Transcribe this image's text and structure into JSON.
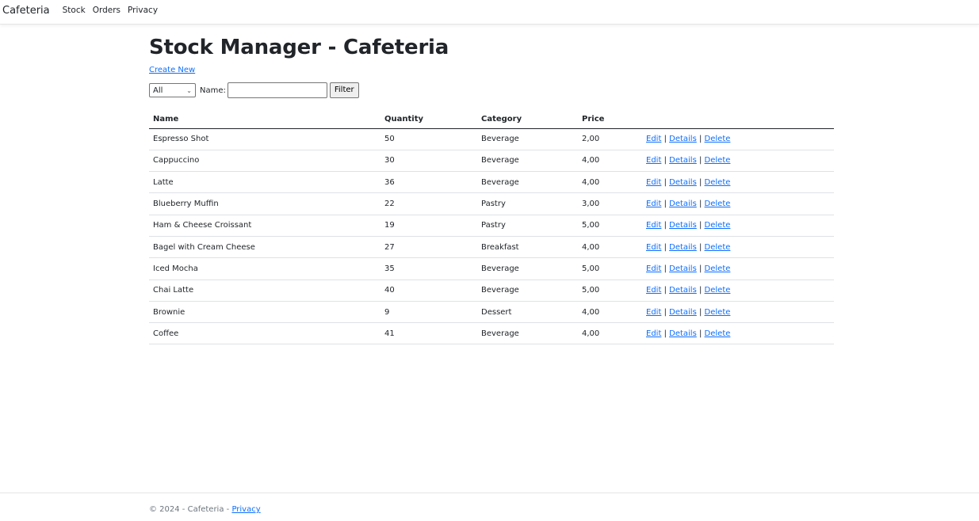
{
  "nav": {
    "brand": "Cafeteria",
    "links": [
      "Stock",
      "Orders",
      "Privacy"
    ]
  },
  "page": {
    "title": "Stock Manager - Cafeteria",
    "create_new": "Create New"
  },
  "filter": {
    "category_selected": "All",
    "name_label": "Name:",
    "name_value": "",
    "button_label": "Filter"
  },
  "table": {
    "headers": [
      "Name",
      "Quantity",
      "Category",
      "Price"
    ],
    "rows": [
      {
        "name": "Espresso Shot",
        "quantity": "50",
        "category": "Beverage",
        "price": "2,00"
      },
      {
        "name": "Cappuccino",
        "quantity": "30",
        "category": "Beverage",
        "price": "4,00"
      },
      {
        "name": "Latte",
        "quantity": "36",
        "category": "Beverage",
        "price": "4,00"
      },
      {
        "name": "Blueberry Muffin",
        "quantity": "22",
        "category": "Pastry",
        "price": "3,00"
      },
      {
        "name": "Ham & Cheese Croissant",
        "quantity": "19",
        "category": "Pastry",
        "price": "5,00"
      },
      {
        "name": "Bagel with Cream Cheese",
        "quantity": "27",
        "category": "Breakfast",
        "price": "4,00"
      },
      {
        "name": "Iced Mocha",
        "quantity": "35",
        "category": "Beverage",
        "price": "5,00"
      },
      {
        "name": "Chai Latte",
        "quantity": "40",
        "category": "Beverage",
        "price": "5,00"
      },
      {
        "name": "Brownie",
        "quantity": "9",
        "category": "Dessert",
        "price": "4,00"
      },
      {
        "name": "Coffee",
        "quantity": "41",
        "category": "Beverage",
        "price": "4,00"
      }
    ],
    "actions": {
      "edit": "Edit",
      "details": "Details",
      "delete": "Delete",
      "separator": "|"
    }
  },
  "footer": {
    "text": "© 2024 - Cafeteria - ",
    "privacy": "Privacy"
  }
}
